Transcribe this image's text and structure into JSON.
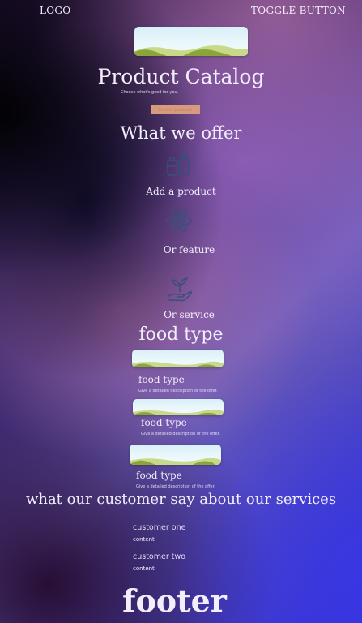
{
  "nav": {
    "logo": "LOGO",
    "toggle": "TOGGLE BUTTON"
  },
  "hero": {
    "title": "Product Catalog",
    "subtitle": "Choose what's good for you.",
    "cta_label": "Browse products"
  },
  "offer": {
    "title": "What we offer",
    "items": [
      {
        "label": "Add a product",
        "icon": "bottles-icon"
      },
      {
        "label": "Or feature",
        "icon": "atom-icon"
      },
      {
        "label": "Or service",
        "icon": "hand-sprout-icon"
      }
    ]
  },
  "food": {
    "title": "food type",
    "cards": [
      {
        "title": "food type",
        "description": "Give a detailed description of the offer."
      },
      {
        "title": "food type",
        "description": "Give a detailed description of the offer."
      },
      {
        "title": "food type",
        "description": "Give a detailed description of the offer."
      }
    ]
  },
  "testimonials": {
    "title": "what our customer say about our services",
    "items": [
      {
        "name": "customer one",
        "content": "content"
      },
      {
        "name": "customer two",
        "content": "content"
      }
    ]
  },
  "footer": {
    "label": "footer"
  },
  "colors": {
    "cta": "#d89a7f",
    "icon_stroke": "#3b4f7a",
    "hill_dark": "#8aa63a",
    "hill_light": "#c9d98a"
  }
}
